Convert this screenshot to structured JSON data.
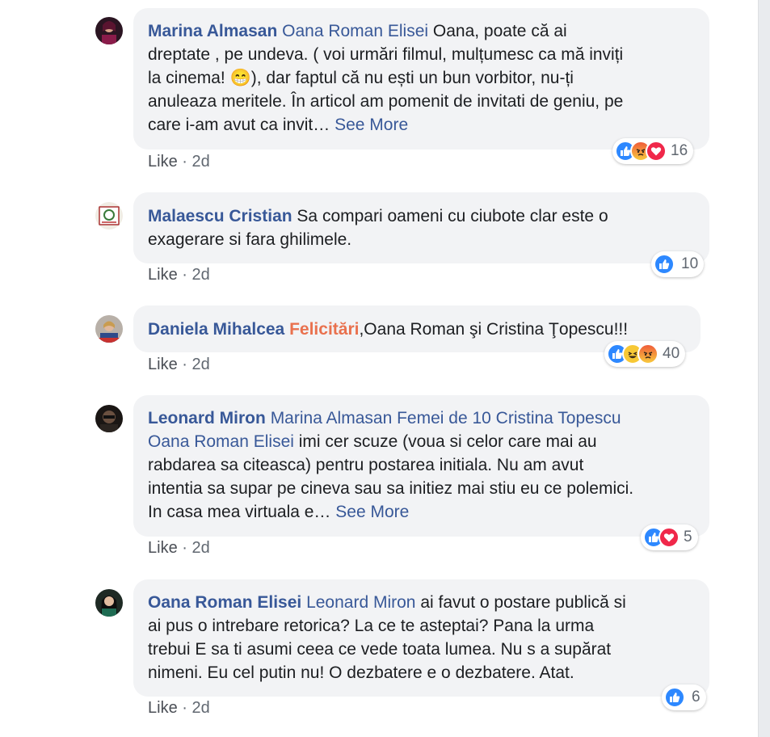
{
  "comments": [
    {
      "author": "Marina Almasan",
      "tags": "Oana Roman Elisei",
      "text_lines": [
        "Oana, poate că ai",
        "dreptate , pe undeva. ( voi urmări filmul, mulțumesc ca mă inviți",
        "la cinema!",
        "), dar faptul că nu ești un bun vorbitor, nu-ți",
        "anuleaza meritele. În articol am pomenit de invitati de geniu, pe",
        "care i-am avut ca invit…"
      ],
      "emoji": "😁",
      "see_more": "See More",
      "like": "Like",
      "sep": "·",
      "time": "2d",
      "reactions": [
        "like",
        "angry",
        "love"
      ],
      "count": "16"
    },
    {
      "author": "Malaescu Cristian",
      "text_lines": [
        "Sa compari oameni cu ciubote clar este o",
        "exagerare si fara ghilimele."
      ],
      "like": "Like",
      "sep": "·",
      "time": "2d",
      "reactions": [
        "like"
      ],
      "count": "10"
    },
    {
      "author": "Daniela Mihalcea",
      "highlight": "Felicitări",
      "text": ",Oana Roman şi Cristina Ţopescu!!!",
      "like": "Like",
      "sep": "·",
      "time": "2d",
      "reactions": [
        "like",
        "haha",
        "angry"
      ],
      "count": "40"
    },
    {
      "author": "Leonard Miron",
      "tags_line1": "Marina Almasan Femei de 10 Cristina Topescu",
      "tags_line2": "Oana Roman Elisei",
      "text_lines": [
        "imi cer scuze (voua si celor care mai au",
        "rabdarea sa citeasca) pentru postarea initiala. Nu am avut",
        "intentia sa supar pe cineva sau sa initiez mai stiu eu ce polemici.",
        "In casa mea virtuala e…"
      ],
      "see_more": "See More",
      "like": "Like",
      "sep": "·",
      "time": "2d",
      "reactions": [
        "like",
        "love"
      ],
      "count": "5"
    },
    {
      "author": "Oana Roman Elisei",
      "tags": "Leonard Miron",
      "text_lines": [
        "ai favut o postare publică si",
        "ai pus o intrebare retorica? La ce te asteptai? Pana la urma",
        "trebui E sa ti asumi ceea ce vede toata lumea. Nu s a supărat",
        "nimeni. Eu cel putin nu! O dezbatere e o dezbatere. Atat."
      ],
      "like": "Like",
      "sep": "·",
      "time": "2d",
      "reactions": [
        "like"
      ],
      "count": "6"
    }
  ],
  "colors": {
    "author": "#385898",
    "highlight": "#e9714e",
    "bubble": "#f2f3f5",
    "like_blue": "#2d88ff",
    "love_red": "#f0284a"
  }
}
